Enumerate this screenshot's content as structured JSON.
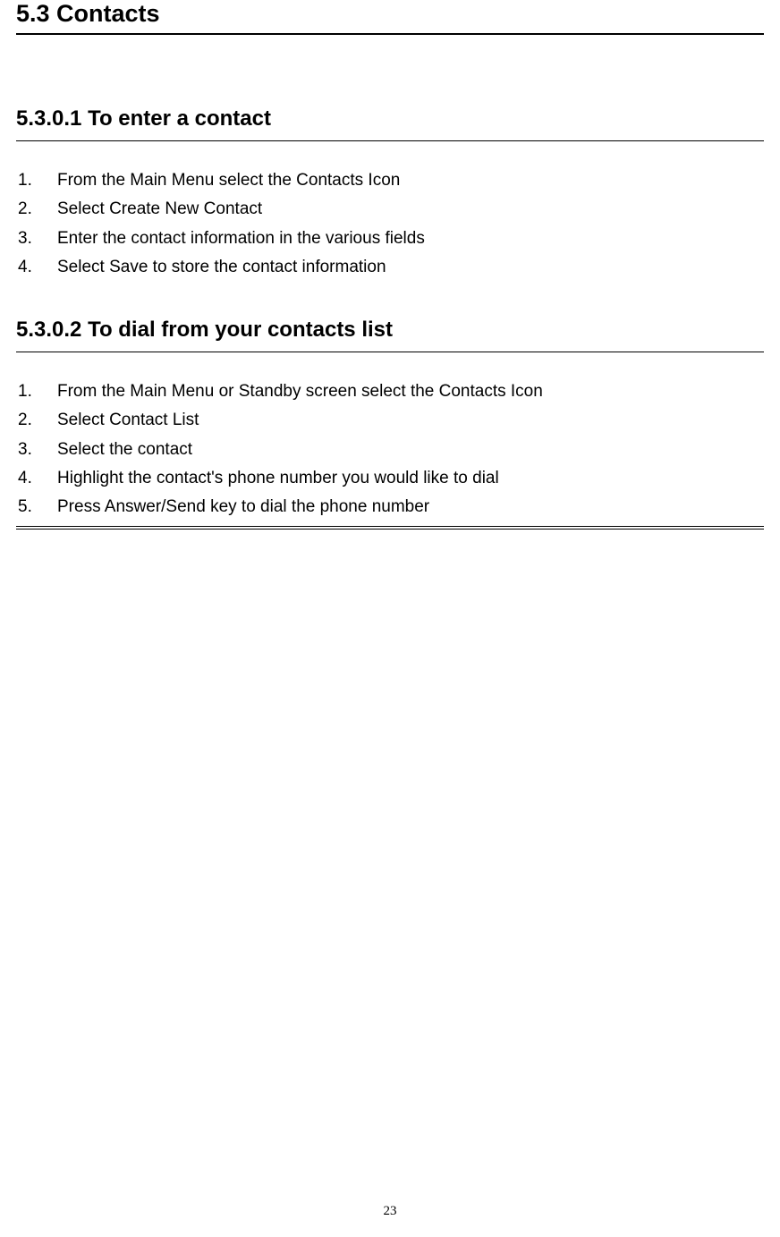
{
  "main_heading": "5.3 Contacts",
  "section1": {
    "heading": "5.3.0.1 To enter a contact",
    "items": [
      {
        "num": "1.",
        "text": "From the Main Menu select the Contacts Icon"
      },
      {
        "num": "2.",
        "text": "Select Create New Contact"
      },
      {
        "num": "3.",
        "text": "Enter the contact information in the various fields"
      },
      {
        "num": "4.",
        "text": "Select Save to store the contact information"
      }
    ]
  },
  "section2": {
    "heading": "5.3.0.2 To dial from your contacts list",
    "items": [
      {
        "num": "1.",
        "text": "From the Main Menu or Standby screen select the Contacts Icon"
      },
      {
        "num": "2.",
        "text": "Select Contact List"
      },
      {
        "num": "3.",
        "text": "Select the contact"
      },
      {
        "num": "4.",
        "text": "Highlight the contact's phone number you would like to dial"
      },
      {
        "num": "5.",
        "text": "Press Answer/Send key to dial the phone number"
      }
    ]
  },
  "page_number": "23"
}
